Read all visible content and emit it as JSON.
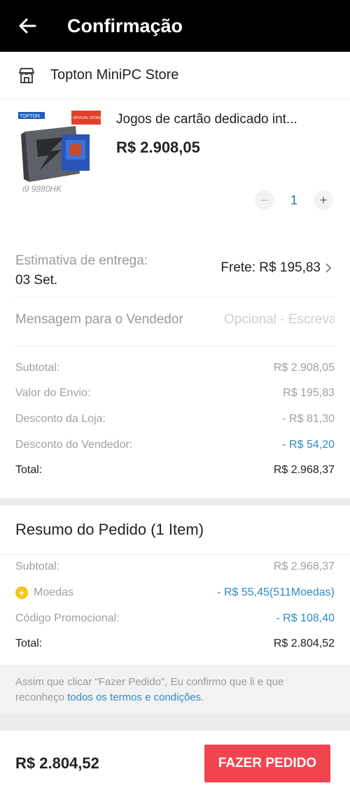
{
  "header": {
    "title": "Confirmação"
  },
  "store": {
    "name": "Topton MiniPC Store",
    "icon": "store-icon"
  },
  "product": {
    "title": "Jogos de cartão dedicado int...",
    "price": "R$ 2.908,05",
    "quantity": "1",
    "minus": "−",
    "plus": "+",
    "thumb_texts": {
      "brand": "TOPTON",
      "badge": "OFFICIAL STORE",
      "cpu": "i9 9880HK"
    }
  },
  "shipping": {
    "label": "Estimativa de entrega:",
    "date": "03 Set.",
    "fee": "Frete: R$ 195,83"
  },
  "message": {
    "label": "Mensagem para o Vendedor",
    "placeholder": "Opcional - Escreva"
  },
  "store_summary": [
    {
      "label": "Subtotal:",
      "value": "R$ 2.908,05",
      "style": "gray"
    },
    {
      "label": "Valor do Envio:",
      "value": "R$ 195,83",
      "style": "gray"
    },
    {
      "label": "Desconto da Loja:",
      "value": "- R$ 81,30",
      "style": "gray"
    },
    {
      "label": "Desconto do Vendedor:",
      "value": "- R$ 54,20",
      "style": "blue"
    },
    {
      "label": "Total:",
      "value": "R$ 2.968,37",
      "style": "total"
    }
  ],
  "order_summary": {
    "title": "Resumo do Pedido (1 Item)",
    "rows": [
      {
        "label": "Subtotal:",
        "value": "R$ 2.968,37"
      },
      {
        "label": "Moedas",
        "value": "- R$ 55,45(511Moedas)",
        "coin_glyph": "+"
      },
      {
        "label": "Código Promocional:",
        "value": "- R$ 108,40"
      },
      {
        "label": "Total:",
        "value": "R$ 2.804,52"
      }
    ]
  },
  "terms": {
    "text": "Assim que clicar \"Fazer Pedido\", Eu confirmo que li e que reconheço ",
    "link": "todos os termos e condições",
    "end": "."
  },
  "footer": {
    "total": "R$ 2.804,52",
    "button": "FAZER PEDIDO"
  },
  "colors": {
    "accent": "#f0454e",
    "link": "#2f8bc4",
    "header": "#000000"
  }
}
